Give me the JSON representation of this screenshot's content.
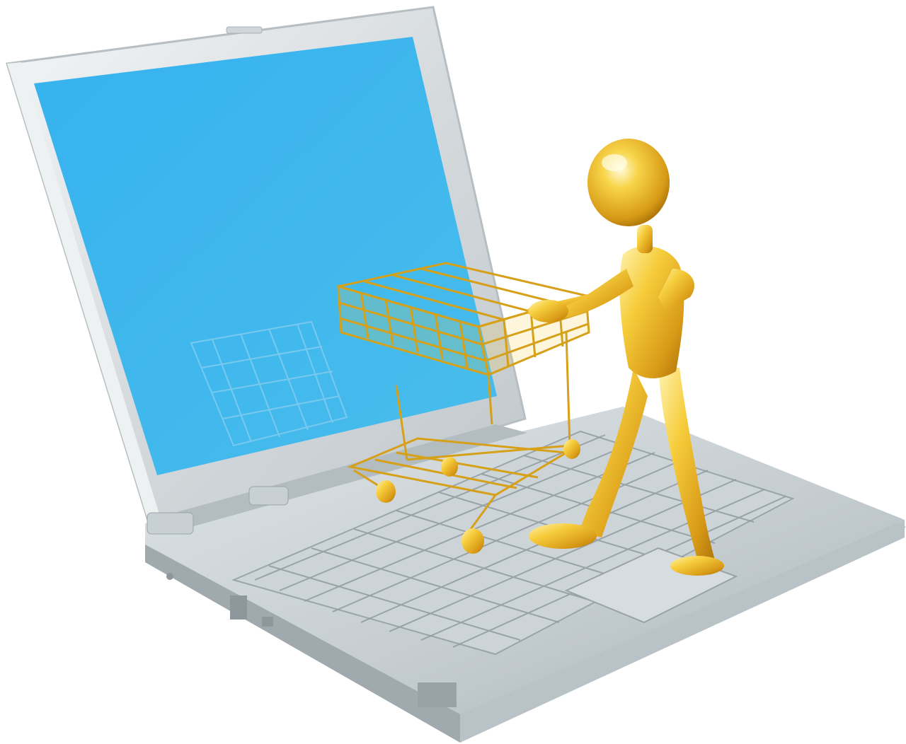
{
  "image": {
    "subject": "gold-figure-shopping-cart-on-laptop",
    "colors": {
      "background": "#ffffff",
      "screen": "#3bb4ec",
      "silver": "#c9d1d6",
      "silver_dark": "#8e999f",
      "key": "#e6ecef",
      "gold": "#f2c12e",
      "gold_light": "#fff1a8",
      "gold_dark": "#a9710a"
    }
  }
}
